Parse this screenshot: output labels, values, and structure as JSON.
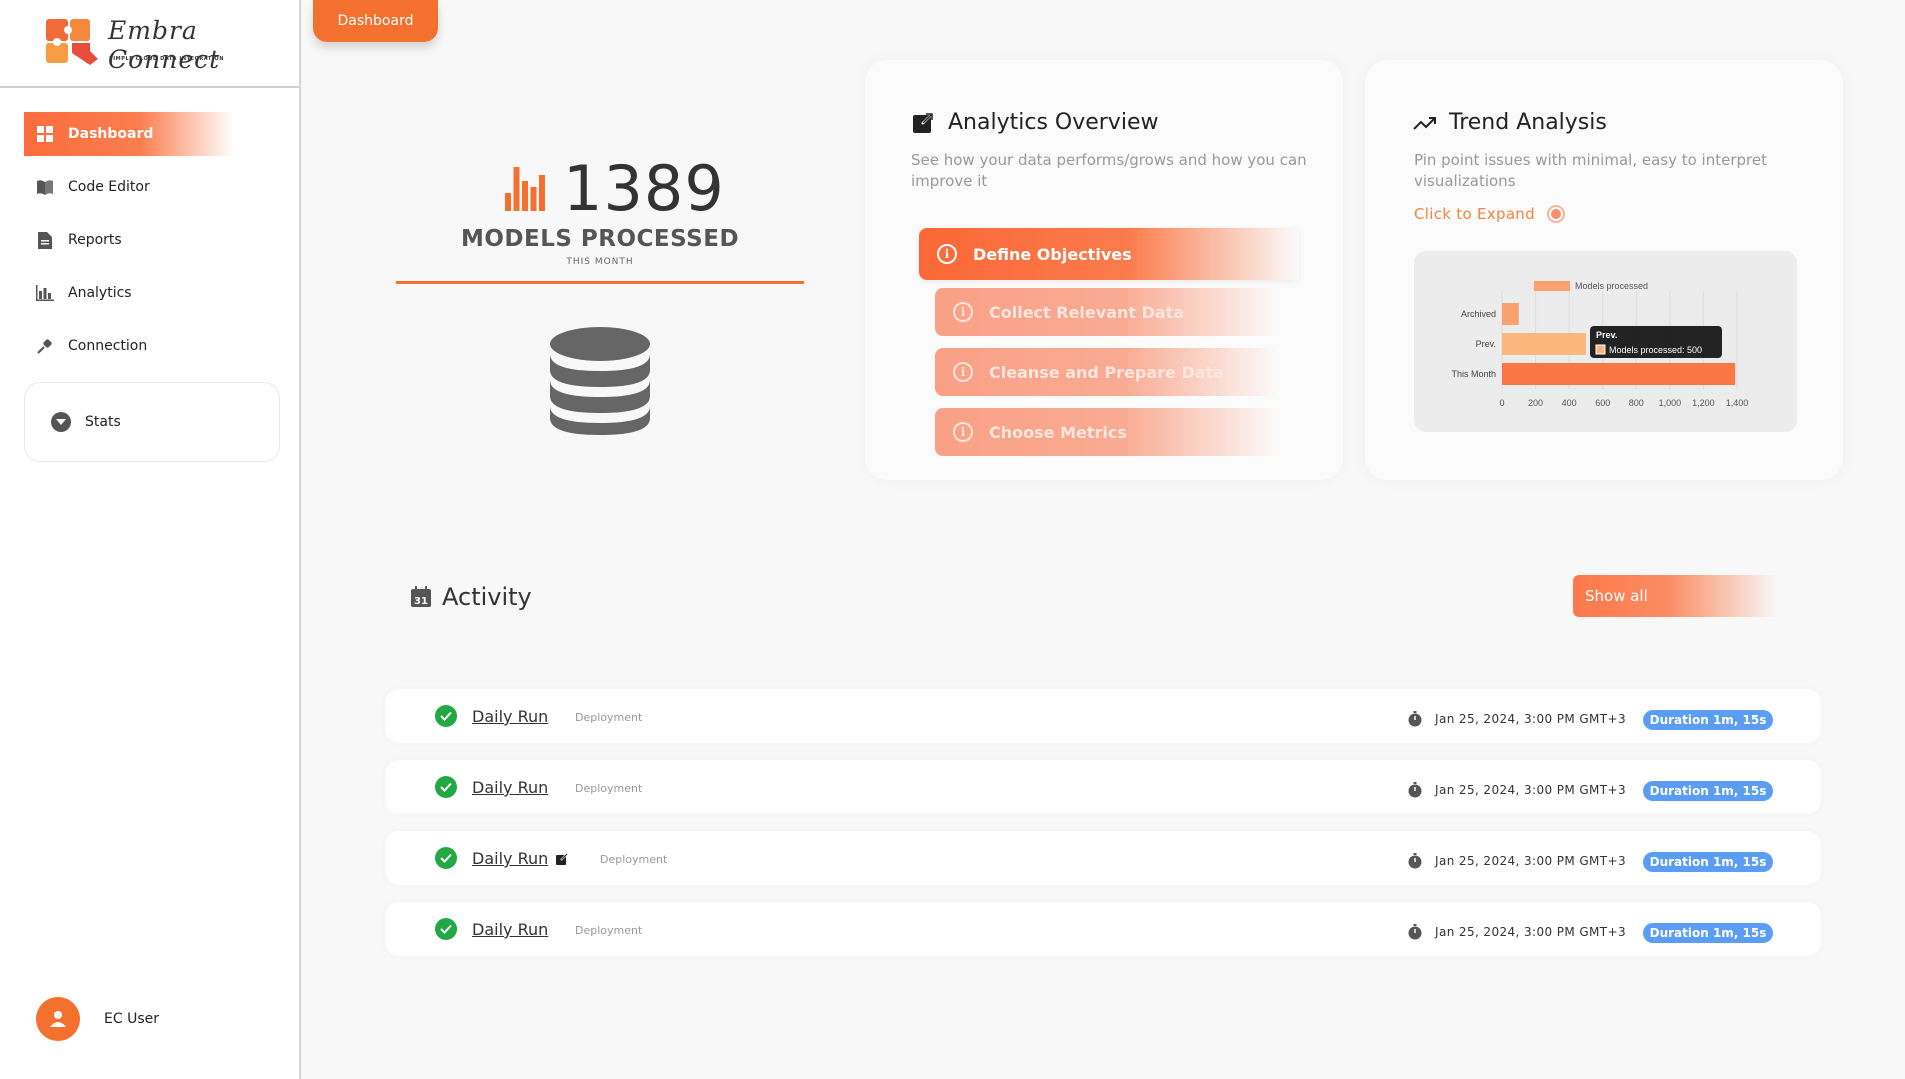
{
  "brand": {
    "name": "Embra Connect",
    "tagline": "SIMPLE CLOUD DATA INTEGRATION"
  },
  "top_tab": {
    "label": "Dashboard"
  },
  "sidebar": {
    "items": [
      {
        "label": "Dashboard",
        "icon": "grid-icon",
        "active": true
      },
      {
        "label": "Code Editor",
        "icon": "book-icon"
      },
      {
        "label": "Reports",
        "icon": "document-icon"
      },
      {
        "label": "Analytics",
        "icon": "bar-chart-icon"
      },
      {
        "label": "Connection",
        "icon": "plug-icon"
      }
    ],
    "stats": {
      "label": "Stats",
      "icon": "chevron-down-circle-icon"
    },
    "user": {
      "name": "EC User"
    }
  },
  "stat": {
    "count": "1389",
    "title": "MODELS PROCESSED",
    "subtitle": "THIS MONTH",
    "accent": "#f4702f"
  },
  "analytics": {
    "title": "Analytics Overview",
    "description": "See how your data performs/grows and how you can improve it",
    "steps": [
      {
        "label": "Define Objectives"
      },
      {
        "label": "Collect Relevant Data"
      },
      {
        "label": "Cleanse and Prepare Data"
      },
      {
        "label": "Choose Metrics"
      }
    ]
  },
  "trend": {
    "title": "Trend Analysis",
    "description": "Pin point issues with minimal, easy to interpret visualizations",
    "expand_label": "Click to Expand"
  },
  "chart_data": {
    "type": "bar",
    "orientation": "horizontal",
    "categories": [
      "Archived",
      "Prev.",
      "This Month"
    ],
    "series": [
      {
        "name": "Models processed",
        "values": [
          100,
          500,
          1389
        ]
      }
    ],
    "xlim": [
      0,
      1400
    ],
    "xticks": [
      "0",
      "200",
      "400",
      "600",
      "800",
      "1,000",
      "1,200",
      "1,400"
    ],
    "legend": "top",
    "tooltip": {
      "title": "Prev.",
      "text": "Models processed: 500"
    },
    "colors": [
      "#f9a26f",
      "#f9b77e",
      "#fb7845"
    ]
  },
  "activity": {
    "title": "Activity",
    "calendar_day": "31",
    "show_all": "Show all",
    "rows": [
      {
        "name": "Daily Run",
        "tag": "Deployment",
        "date": "Jan 25, 2024, 3:00 PM GMT+3",
        "duration": "Duration 1m, 15s"
      },
      {
        "name": "Daily Run",
        "tag": "Deployment",
        "date": "Jan 25, 2024, 3:00 PM GMT+3",
        "duration": "Duration 1m, 15s"
      },
      {
        "name": "Daily Run",
        "tag": "Deployment",
        "date": "Jan 25, 2024, 3:00 PM GMT+3",
        "duration": "Duration 1m, 15s",
        "edit_icon": "edit-icon"
      },
      {
        "name": "Daily Run",
        "tag": "Deployment",
        "date": "Jan 25, 2024, 3:00 PM GMT+3",
        "duration": "Duration 1m, 15s"
      }
    ]
  }
}
